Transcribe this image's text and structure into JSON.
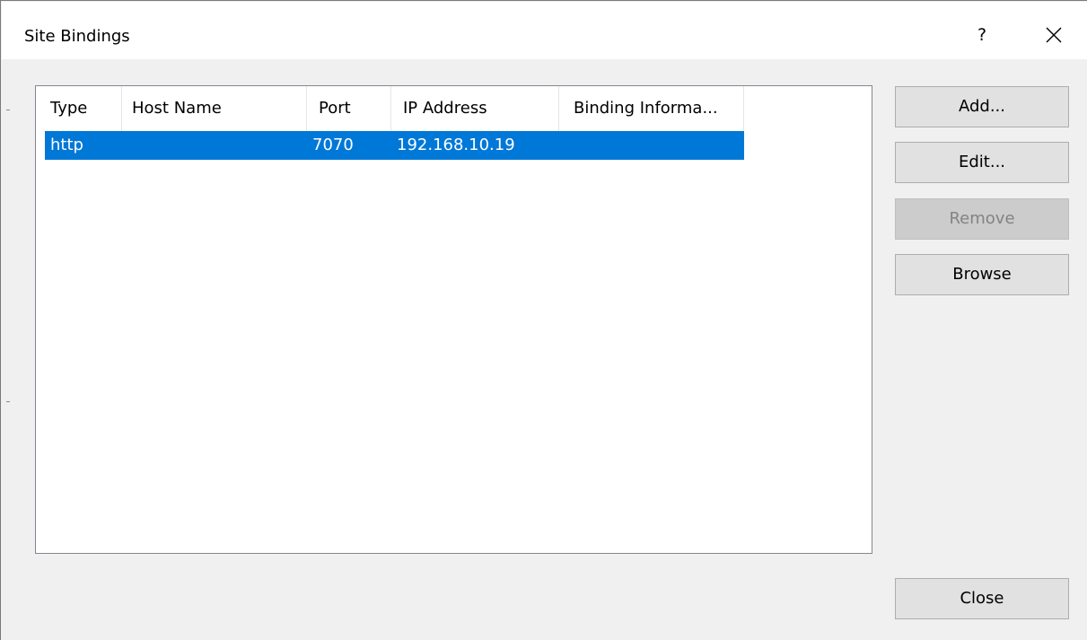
{
  "dialog": {
    "title": "Site Bindings",
    "help_label": "?",
    "close_icon": "close-icon"
  },
  "list": {
    "columns": [
      "Type",
      "Host Name",
      "Port",
      "IP Address",
      "Binding Informa..."
    ],
    "rows": [
      {
        "type": "http",
        "host_name": "",
        "port": "7070",
        "ip_address": "192.168.10.19",
        "binding_information": "",
        "selected": true
      }
    ]
  },
  "buttons": {
    "add": "Add...",
    "edit": "Edit...",
    "remove": "Remove",
    "browse": "Browse",
    "close": "Close"
  },
  "colors": {
    "selection": "#0078d7",
    "dialog_background": "#f0f0f0",
    "disabled_button": "#cccccc"
  }
}
